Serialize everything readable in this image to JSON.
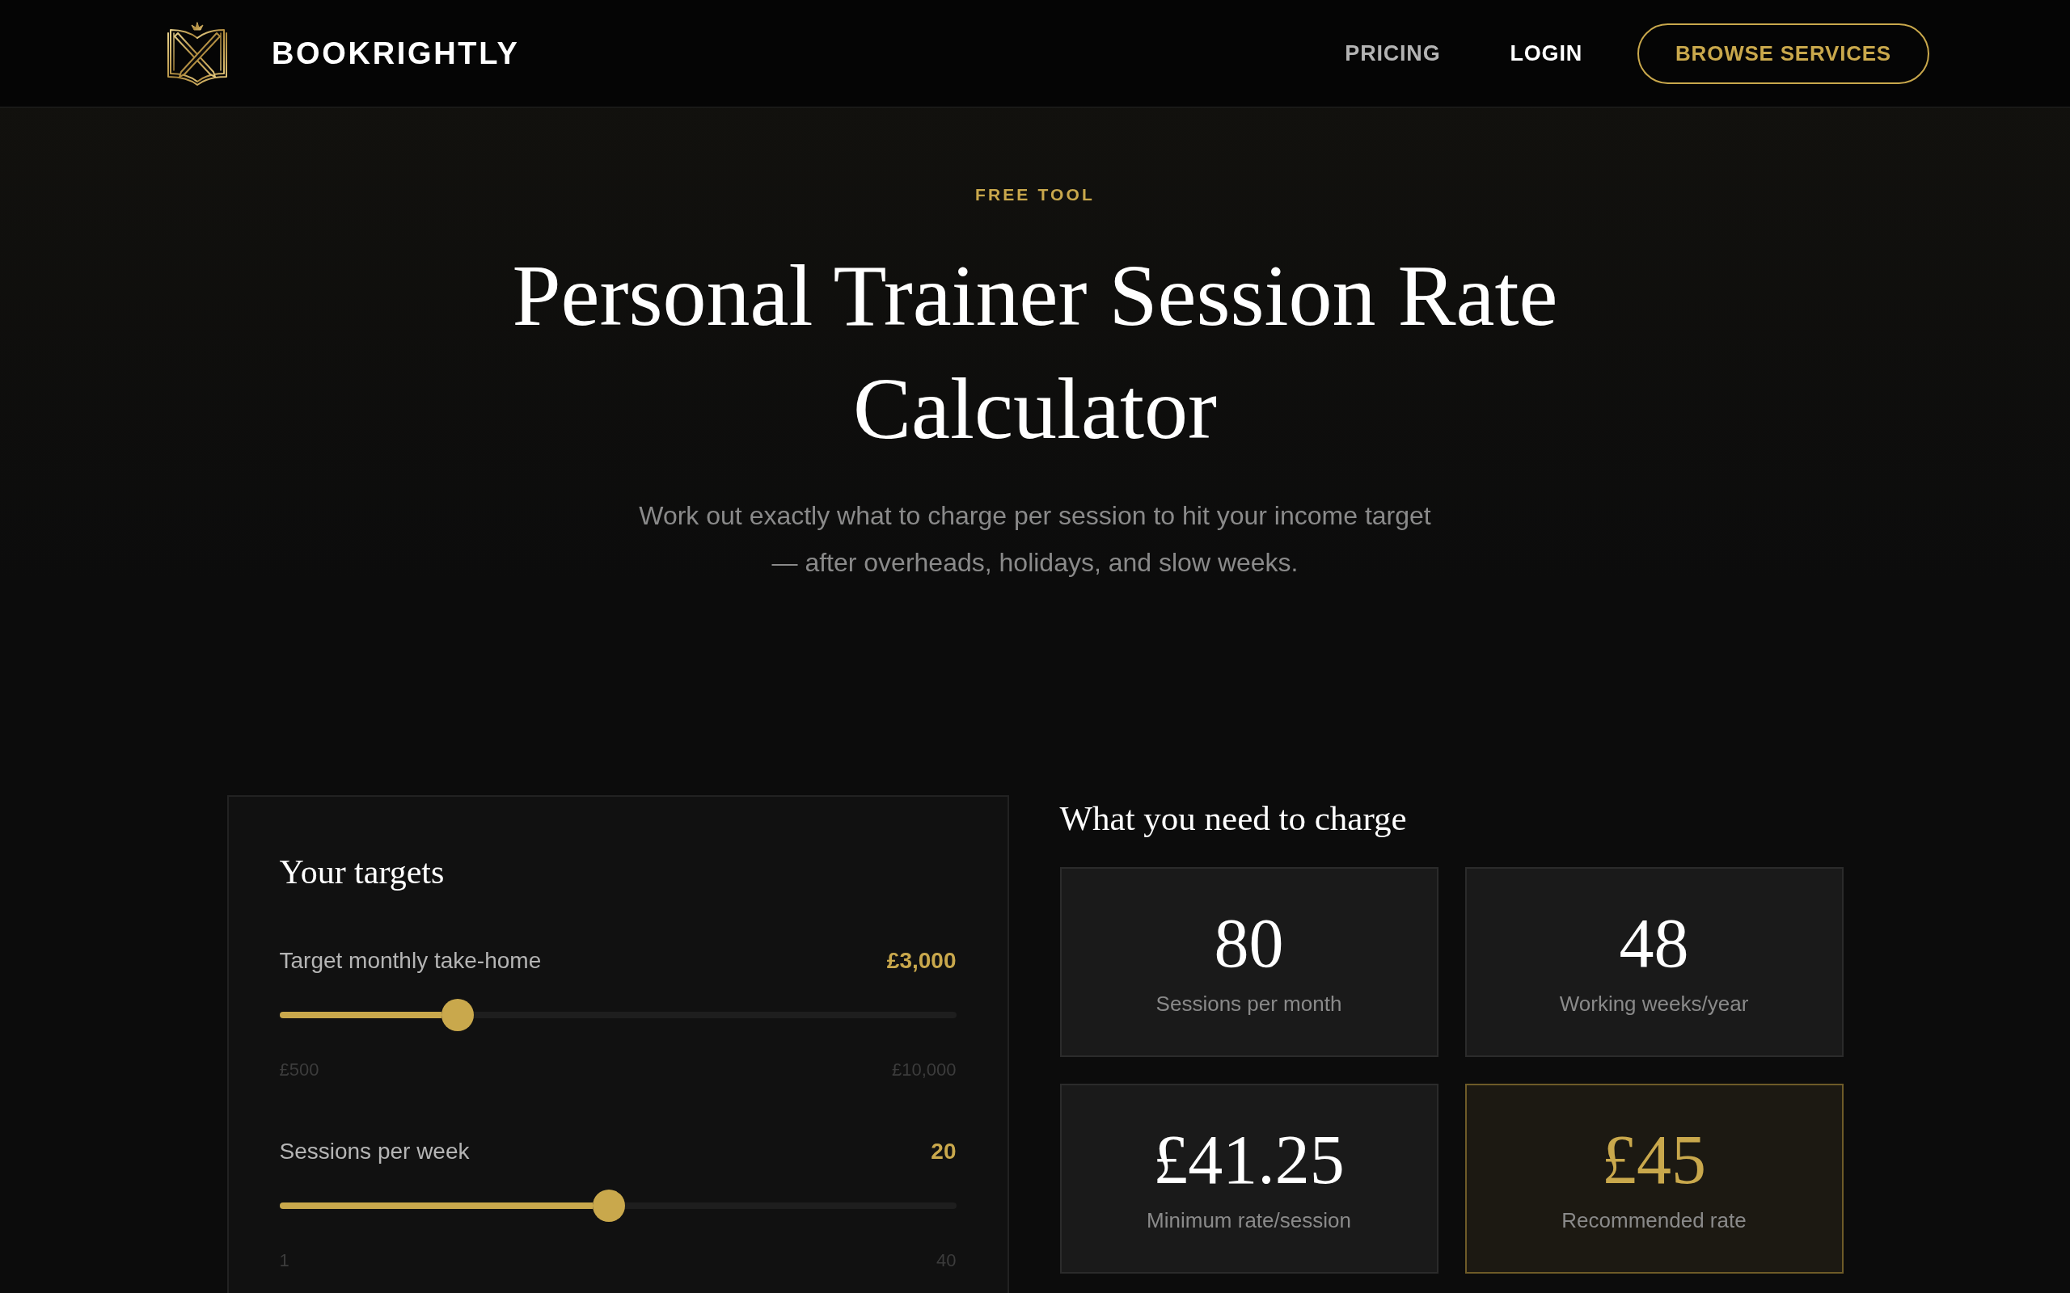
{
  "header": {
    "brand": "BOOKRIGHTLY",
    "nav": [
      {
        "label": "PRICING",
        "emphasized": false
      },
      {
        "label": "LOGIN",
        "emphasized": true
      }
    ],
    "cta": "BROWSE SERVICES"
  },
  "hero": {
    "eyebrow": "FREE TOOL",
    "title": "Personal Trainer Session Rate Calculator",
    "subtitle": "Work out exactly what to charge per session to hit your income target — after overheads, holidays, and slow weeks."
  },
  "targets": {
    "title": "Your targets",
    "sliders": [
      {
        "label": "Target monthly take-home",
        "value": "£3,000",
        "level": 0.263,
        "min": "£500",
        "max": "£10,000"
      },
      {
        "label": "Sessions per week",
        "value": "20",
        "level": 0.487,
        "min": "1",
        "max": "40"
      }
    ]
  },
  "results": {
    "title": "What you need to charge",
    "stats": [
      {
        "value": "80",
        "label": "Sessions per month",
        "highlighted": false
      },
      {
        "value": "48",
        "label": "Working weeks/year",
        "highlighted": false
      },
      {
        "value": "£41.25",
        "label": "Minimum rate/session",
        "highlighted": false
      },
      {
        "value": "£45",
        "label": "Recommended rate",
        "highlighted": true
      }
    ]
  }
}
